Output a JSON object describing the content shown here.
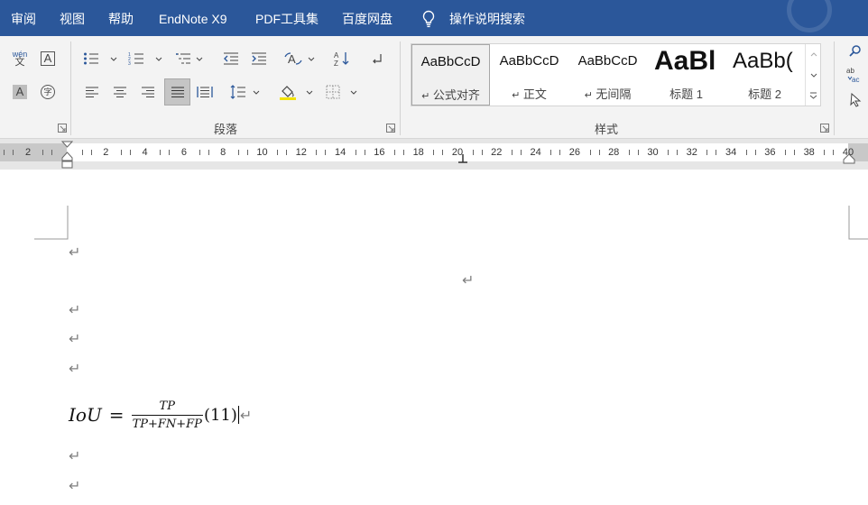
{
  "tabs": [
    {
      "label": "审阅"
    },
    {
      "label": "视图"
    },
    {
      "label": "帮助"
    },
    {
      "label": "EndNote X9"
    },
    {
      "label": "PDF工具集"
    },
    {
      "label": "百度网盘"
    }
  ],
  "tell_me": {
    "label": "操作说明搜索",
    "icon": "lightbulb-icon"
  },
  "ribbon": {
    "paragraph_group_label": "段落",
    "styles_group_label": "样式",
    "font_buttons": {
      "phonetic_text": "wén",
      "phonetic_char": "文",
      "char_border": "A",
      "char_shading": "A",
      "enclose_char": "字"
    }
  },
  "styles": [
    {
      "preview": "AaBbCcD",
      "name": "公式对齐",
      "mark": "↵",
      "selected": true
    },
    {
      "preview": "AaBbCcD",
      "name": "正文",
      "mark": "↵",
      "selected": false
    },
    {
      "preview": "AaBbCcD",
      "name": "无间隔",
      "mark": "↵",
      "selected": false
    },
    {
      "preview": "AaBl",
      "name": "标题 1",
      "mark": "",
      "selected": false
    },
    {
      "preview": "AaBb(",
      "name": "标题 2",
      "mark": "",
      "selected": false
    }
  ],
  "ruler": {
    "numbers": [
      "2",
      "2",
      "4",
      "6",
      "8",
      "10",
      "12",
      "14",
      "16",
      "18",
      "20",
      "22",
      "24",
      "26",
      "28",
      "30",
      "32",
      "34",
      "36",
      "38",
      "40"
    ]
  },
  "document": {
    "paragraph_mark": "↵",
    "equation": {
      "lhs": "IoU",
      "equals": "=",
      "numerator": "TP",
      "denominator": "TP+FN+FP",
      "number": "(11)"
    }
  },
  "colors": {
    "title_bar": "#2b579a",
    "ribbon": "#f3f3f3",
    "selected_button": "#c5c5c5"
  }
}
